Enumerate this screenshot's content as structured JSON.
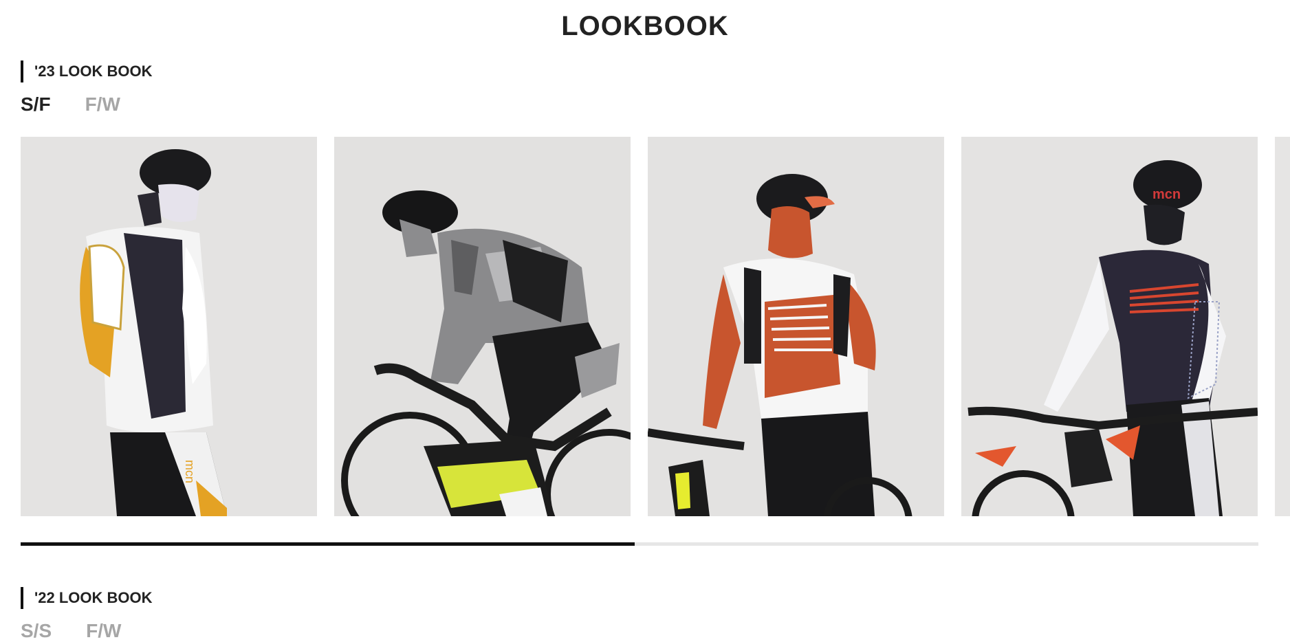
{
  "page": {
    "title": "LOOKBOOK"
  },
  "sections": [
    {
      "heading": "'23 LOOK BOOK",
      "tabs": [
        {
          "label": "S/F",
          "active": true
        },
        {
          "label": "F/W",
          "active": false
        }
      ]
    },
    {
      "heading": "'22 LOOK BOOK",
      "tabs": [
        {
          "label": "S/S",
          "active": false
        },
        {
          "label": "F/W",
          "active": false
        }
      ]
    }
  ],
  "gallery": {
    "slides": [
      {
        "alt": "Rider in white, black and yellow cycling jersey with mask"
      },
      {
        "alt": "Rider in camo cycling jacket on SCOTT bike"
      },
      {
        "alt": "Rider in orange and white jersey holding bike"
      },
      {
        "alt": "Rider in navy jersey with red stripes holding bike"
      },
      {
        "alt": ""
      }
    ],
    "scroll_progress": 0.496
  },
  "colors": {
    "accent": "#111111",
    "inactive_tab": "#a6a6a6",
    "track": "#e6e6e6"
  }
}
